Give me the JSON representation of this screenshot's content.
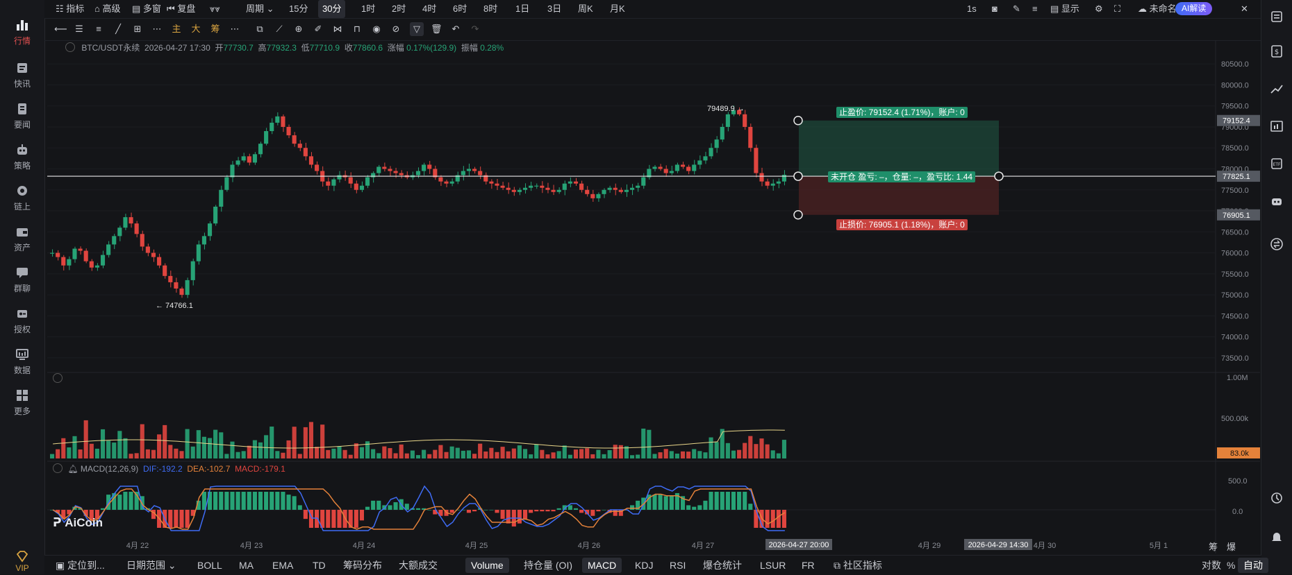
{
  "nav": {
    "items": [
      {
        "label": "行情",
        "icon": "bar-chart-icon"
      },
      {
        "label": "快讯",
        "icon": "news-flash-icon"
      },
      {
        "label": "要闻",
        "icon": "article-icon"
      },
      {
        "label": "策略",
        "icon": "robot-icon"
      },
      {
        "label": "链上",
        "icon": "chain-icon"
      },
      {
        "label": "资产",
        "icon": "wallet-icon"
      },
      {
        "label": "群聊",
        "icon": "chat-icon"
      },
      {
        "label": "授权",
        "icon": "key-icon"
      },
      {
        "label": "数据",
        "icon": "monitor-icon"
      },
      {
        "label": "更多",
        "icon": "grid-icon"
      },
      {
        "label": "VIP",
        "icon": "diamond-icon"
      }
    ]
  },
  "toolbar": {
    "indicator": "指标",
    "advanced": "高级",
    "multiwindow": "多窗",
    "replay": "复盘",
    "period": "周期",
    "intervals": [
      "15分",
      "30分",
      "1时",
      "2时",
      "4时",
      "6时",
      "8时",
      "1日",
      "3日",
      "周K",
      "月K"
    ],
    "selected_interval": "30分",
    "refresh": "1s",
    "display": "显示",
    "layout_name": "未命名",
    "ai_button": "AI解读"
  },
  "drawbar": {
    "labels": [
      "主",
      "大",
      "筹"
    ]
  },
  "ohlc": {
    "symbol": "BTC/USDT永续",
    "datetime": "2026-04-27 17:30",
    "open_label": "开",
    "open": "77730.7",
    "high_label": "高",
    "high": "77932.3",
    "low_label": "低",
    "low": "77710.9",
    "close_label": "收",
    "close": "77860.6",
    "change_label": "涨幅",
    "change": "0.17%(129.9)",
    "amp_label": "振幅",
    "amp": "0.28%"
  },
  "orders": {
    "take_profit": "止盈价: 79152.4 (1.71%)，账户: 0",
    "position": "未开仓 盈亏: –，仓量: –，盈亏比: 1.44",
    "stop_loss": "止损价: 76905.1 (1.18%)，账户: 0"
  },
  "chart_data": {
    "type": "candlestick",
    "symbol": "BTC/USDT永续",
    "interval": "30分",
    "y_ticks": [
      "80500.0",
      "80000.0",
      "79500.0",
      "79000.0",
      "78500.0",
      "78000.0",
      "77500.0",
      "77000.0",
      "76500.0",
      "76000.0",
      "75500.0",
      "75000.0",
      "74500.0",
      "74000.0",
      "73500.0"
    ],
    "ylim": [
      73300,
      80800
    ],
    "x_ticks": [
      "4月 22",
      "4月 23",
      "4月 24",
      "4月 25",
      "4月 26",
      "4月 27",
      "4月 29",
      "4月 30",
      "5月 1"
    ],
    "crosshair_date": "2026-04-27 20:00",
    "future_date": "2026-04-29 14:30",
    "high_annotation": "79489.9",
    "low_annotation": "74766.1",
    "price_labels": {
      "take_profit": "79152.4",
      "current": "77825.1",
      "stop_loss": "76905.1"
    },
    "colors": {
      "up": "#27a376",
      "down": "#e0453f",
      "tp": "#1f8f6a",
      "sl": "#c8413e"
    },
    "close_series": [
      76000,
      75900,
      75700,
      75850,
      76100,
      76050,
      75800,
      75650,
      75700,
      75950,
      76200,
      76400,
      76600,
      76850,
      76700,
      76450,
      76150,
      76000,
      75900,
      75700,
      75450,
      75300,
      75150,
      75000,
      75350,
      75800,
      76200,
      76400,
      76700,
      77100,
      77500,
      77800,
      78100,
      78200,
      78300,
      78150,
      78350,
      78600,
      78900,
      79100,
      79250,
      79000,
      78800,
      78600,
      78500,
      78300,
      78100,
      77950,
      77700,
      77600,
      77750,
      77850,
      77800,
      77650,
      77500,
      77600,
      77800,
      77900,
      78050,
      78000,
      77950,
      77900,
      77850,
      77800,
      77850,
      77950,
      78100,
      78000,
      77800,
      77700,
      77650,
      77700,
      77850,
      77950,
      78000,
      77950,
      77850,
      77700,
      77650,
      77600,
      77550,
      77500,
      77450,
      77500,
      77550,
      77600,
      77600,
      77550,
      77500,
      77450,
      77500,
      77650,
      77700,
      77650,
      77500,
      77400,
      77300,
      77400,
      77500,
      77550,
      77500,
      77450,
      77500,
      77550,
      77600,
      77800,
      78000,
      78050,
      78000,
      77900,
      77950,
      78100,
      78050,
      77950,
      78100,
      78200,
      78300,
      78500,
      78700,
      79000,
      79300,
      79400,
      79300,
      79000,
      78500,
      77900,
      77700,
      77600,
      77650,
      77700,
      77860
    ],
    "volume_ticks": [
      "1.00M",
      "500.00k"
    ],
    "volume_current": "83.0k",
    "macd": {
      "label": "MACD(12,26,9)",
      "dif": "DIF:-192.2",
      "dea": "DEA:-102.7",
      "macd": "MACD:-179.1",
      "y_ticks": [
        "500.0",
        "0.0"
      ]
    }
  },
  "bottombar": {
    "locate": "定位到...",
    "daterange": "日期范围",
    "indicators": [
      "BOLL",
      "MA",
      "EMA",
      "TD",
      "筹码分布",
      "大额成交"
    ],
    "sub_indicators": [
      "Volume",
      "持仓量 (OI)",
      "MACD",
      "KDJ",
      "RSI",
      "爆仓统计",
      "LSUR",
      "FR"
    ],
    "community": "社区指标",
    "log": "对数",
    "percent": "%",
    "auto": "自动",
    "right_labels": [
      "筹",
      "爆"
    ]
  },
  "watermark": "AiCoin"
}
